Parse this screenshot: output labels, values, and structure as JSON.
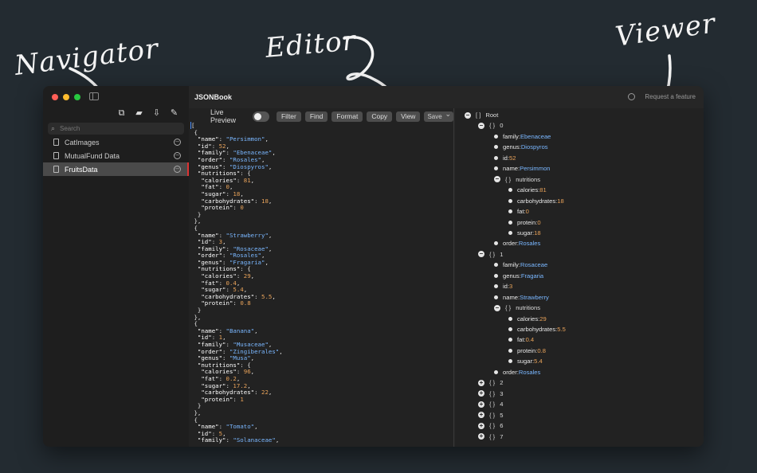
{
  "annotations": {
    "navigator": "Navigator",
    "editor": "Editor",
    "viewer": "Viewer"
  },
  "window": {
    "app_title": "JSONBook",
    "request_feature": "Request a feature"
  },
  "sidebar": {
    "search_placeholder": "Search",
    "files": [
      {
        "label": "CatImages",
        "selected": false
      },
      {
        "label": "MutualFund Data",
        "selected": false
      },
      {
        "label": "FruitsData",
        "selected": true
      }
    ]
  },
  "toolbar": {
    "live_preview": "Live Preview",
    "filter": "Filter",
    "find": "Find",
    "format": "Format",
    "copy": "Copy",
    "view": "View",
    "save": "Save"
  },
  "editor_lines": [
    [
      [
        "p",
        "["
      ]
    ],
    [
      [
        "p",
        " {"
      ]
    ],
    [
      [
        "k",
        "  \"name\""
      ],
      [
        "p",
        ": "
      ],
      [
        "s",
        "\"Persimmon\""
      ],
      [
        "p",
        ","
      ]
    ],
    [
      [
        "k",
        "  \"id\""
      ],
      [
        "p",
        ": "
      ],
      [
        "n",
        "52"
      ],
      [
        "p",
        ","
      ]
    ],
    [
      [
        "k",
        "  \"family\""
      ],
      [
        "p",
        ": "
      ],
      [
        "s",
        "\"Ebenaceae\""
      ],
      [
        "p",
        ","
      ]
    ],
    [
      [
        "k",
        "  \"order\""
      ],
      [
        "p",
        ": "
      ],
      [
        "s",
        "\"Rosales\""
      ],
      [
        "p",
        ","
      ]
    ],
    [
      [
        "k",
        "  \"genus\""
      ],
      [
        "p",
        ": "
      ],
      [
        "s",
        "\"Diospyros\""
      ],
      [
        "p",
        ","
      ]
    ],
    [
      [
        "k",
        "  \"nutritions\""
      ],
      [
        "p",
        ": {"
      ]
    ],
    [
      [
        "k",
        "   \"calories\""
      ],
      [
        "p",
        ": "
      ],
      [
        "n",
        "81"
      ],
      [
        "p",
        ","
      ]
    ],
    [
      [
        "k",
        "   \"fat\""
      ],
      [
        "p",
        ": "
      ],
      [
        "n",
        "0"
      ],
      [
        "p",
        ","
      ]
    ],
    [
      [
        "k",
        "   \"sugar\""
      ],
      [
        "p",
        ": "
      ],
      [
        "n",
        "18"
      ],
      [
        "p",
        ","
      ]
    ],
    [
      [
        "k",
        "   \"carbohydrates\""
      ],
      [
        "p",
        ": "
      ],
      [
        "n",
        "18"
      ],
      [
        "p",
        ","
      ]
    ],
    [
      [
        "k",
        "   \"protein\""
      ],
      [
        "p",
        ": "
      ],
      [
        "n",
        "0"
      ]
    ],
    [
      [
        "p",
        "  }"
      ]
    ],
    [
      [
        "p",
        " },"
      ]
    ],
    [
      [
        "p",
        " {"
      ]
    ],
    [
      [
        "k",
        "  \"name\""
      ],
      [
        "p",
        ": "
      ],
      [
        "s",
        "\"Strawberry\""
      ],
      [
        "p",
        ","
      ]
    ],
    [
      [
        "k",
        "  \"id\""
      ],
      [
        "p",
        ": "
      ],
      [
        "n",
        "3"
      ],
      [
        "p",
        ","
      ]
    ],
    [
      [
        "k",
        "  \"family\""
      ],
      [
        "p",
        ": "
      ],
      [
        "s",
        "\"Rosaceae\""
      ],
      [
        "p",
        ","
      ]
    ],
    [
      [
        "k",
        "  \"order\""
      ],
      [
        "p",
        ": "
      ],
      [
        "s",
        "\"Rosales\""
      ],
      [
        "p",
        ","
      ]
    ],
    [
      [
        "k",
        "  \"genus\""
      ],
      [
        "p",
        ": "
      ],
      [
        "s",
        "\"Fragaria\""
      ],
      [
        "p",
        ","
      ]
    ],
    [
      [
        "k",
        "  \"nutritions\""
      ],
      [
        "p",
        ": {"
      ]
    ],
    [
      [
        "k",
        "   \"calories\""
      ],
      [
        "p",
        ": "
      ],
      [
        "n",
        "29"
      ],
      [
        "p",
        ","
      ]
    ],
    [
      [
        "k",
        "   \"fat\""
      ],
      [
        "p",
        ": "
      ],
      [
        "n",
        "0.4"
      ],
      [
        "p",
        ","
      ]
    ],
    [
      [
        "k",
        "   \"sugar\""
      ],
      [
        "p",
        ": "
      ],
      [
        "n",
        "5.4"
      ],
      [
        "p",
        ","
      ]
    ],
    [
      [
        "k",
        "   \"carbohydrates\""
      ],
      [
        "p",
        ": "
      ],
      [
        "n",
        "5.5"
      ],
      [
        "p",
        ","
      ]
    ],
    [
      [
        "k",
        "   \"protein\""
      ],
      [
        "p",
        ": "
      ],
      [
        "n",
        "0.8"
      ]
    ],
    [
      [
        "p",
        "  }"
      ]
    ],
    [
      [
        "p",
        " },"
      ]
    ],
    [
      [
        "p",
        " {"
      ]
    ],
    [
      [
        "k",
        "  \"name\""
      ],
      [
        "p",
        ": "
      ],
      [
        "s",
        "\"Banana\""
      ],
      [
        "p",
        ","
      ]
    ],
    [
      [
        "k",
        "  \"id\""
      ],
      [
        "p",
        ": "
      ],
      [
        "n",
        "1"
      ],
      [
        "p",
        ","
      ]
    ],
    [
      [
        "k",
        "  \"family\""
      ],
      [
        "p",
        ": "
      ],
      [
        "s",
        "\"Musaceae\""
      ],
      [
        "p",
        ","
      ]
    ],
    [
      [
        "k",
        "  \"order\""
      ],
      [
        "p",
        ": "
      ],
      [
        "s",
        "\"Zingiberales\""
      ],
      [
        "p",
        ","
      ]
    ],
    [
      [
        "k",
        "  \"genus\""
      ],
      [
        "p",
        ": "
      ],
      [
        "s",
        "\"Musa\""
      ],
      [
        "p",
        ","
      ]
    ],
    [
      [
        "k",
        "  \"nutritions\""
      ],
      [
        "p",
        ": {"
      ]
    ],
    [
      [
        "k",
        "   \"calories\""
      ],
      [
        "p",
        ": "
      ],
      [
        "n",
        "96"
      ],
      [
        "p",
        ","
      ]
    ],
    [
      [
        "k",
        "   \"fat\""
      ],
      [
        "p",
        ": "
      ],
      [
        "n",
        "0.2"
      ],
      [
        "p",
        ","
      ]
    ],
    [
      [
        "k",
        "   \"sugar\""
      ],
      [
        "p",
        ": "
      ],
      [
        "n",
        "17.2"
      ],
      [
        "p",
        ","
      ]
    ],
    [
      [
        "k",
        "   \"carbohydrates\""
      ],
      [
        "p",
        ": "
      ],
      [
        "n",
        "22"
      ],
      [
        "p",
        ","
      ]
    ],
    [
      [
        "k",
        "   \"protein\""
      ],
      [
        "p",
        ": "
      ],
      [
        "n",
        "1"
      ]
    ],
    [
      [
        "p",
        "  }"
      ]
    ],
    [
      [
        "p",
        " },"
      ]
    ],
    [
      [
        "p",
        " {"
      ]
    ],
    [
      [
        "k",
        "  \"name\""
      ],
      [
        "p",
        ": "
      ],
      [
        "s",
        "\"Tomato\""
      ],
      [
        "p",
        ","
      ]
    ],
    [
      [
        "k",
        "  \"id\""
      ],
      [
        "p",
        ": "
      ],
      [
        "n",
        "5"
      ],
      [
        "p",
        ","
      ]
    ],
    [
      [
        "k",
        "  \"family\""
      ],
      [
        "p",
        ": "
      ],
      [
        "s",
        "\"Solanaceae\""
      ],
      [
        "p",
        ","
      ]
    ]
  ],
  "viewer_nodes": [
    {
      "depth": 0,
      "kind": "toggle-open",
      "bracket": "[ ]",
      "label": "Root"
    },
    {
      "depth": 1,
      "kind": "toggle-open",
      "bracket": "{ }",
      "label": "0"
    },
    {
      "depth": 2,
      "kind": "leaf",
      "key": "family",
      "value": "Ebenaceae",
      "vtype": "s"
    },
    {
      "depth": 2,
      "kind": "leaf",
      "key": "genus",
      "value": "Diospyros",
      "vtype": "s"
    },
    {
      "depth": 2,
      "kind": "leaf",
      "key": "id",
      "value": "52",
      "vtype": "n"
    },
    {
      "depth": 2,
      "kind": "leaf",
      "key": "name",
      "value": "Persimmon",
      "vtype": "s"
    },
    {
      "depth": 2,
      "kind": "toggle-open",
      "bracket": "{ }",
      "label": "nutritions"
    },
    {
      "depth": 3,
      "kind": "leaf",
      "key": "calories",
      "value": "81",
      "vtype": "n"
    },
    {
      "depth": 3,
      "kind": "leaf",
      "key": "carbohydrates",
      "value": "18",
      "vtype": "n"
    },
    {
      "depth": 3,
      "kind": "leaf",
      "key": "fat",
      "value": "0",
      "vtype": "n"
    },
    {
      "depth": 3,
      "kind": "leaf",
      "key": "protein",
      "value": "0",
      "vtype": "n"
    },
    {
      "depth": 3,
      "kind": "leaf",
      "key": "sugar",
      "value": "18",
      "vtype": "n"
    },
    {
      "depth": 2,
      "kind": "leaf",
      "key": "order",
      "value": "Rosales",
      "vtype": "s"
    },
    {
      "depth": 1,
      "kind": "toggle-open",
      "bracket": "{ }",
      "label": "1"
    },
    {
      "depth": 2,
      "kind": "leaf",
      "key": "family",
      "value": "Rosaceae",
      "vtype": "s"
    },
    {
      "depth": 2,
      "kind": "leaf",
      "key": "genus",
      "value": "Fragaria",
      "vtype": "s"
    },
    {
      "depth": 2,
      "kind": "leaf",
      "key": "id",
      "value": "3",
      "vtype": "n"
    },
    {
      "depth": 2,
      "kind": "leaf",
      "key": "name",
      "value": "Strawberry",
      "vtype": "s"
    },
    {
      "depth": 2,
      "kind": "toggle-open",
      "bracket": "{ }",
      "label": "nutritions"
    },
    {
      "depth": 3,
      "kind": "leaf",
      "key": "calories",
      "value": "29",
      "vtype": "n"
    },
    {
      "depth": 3,
      "kind": "leaf",
      "key": "carbohydrates",
      "value": "5.5",
      "vtype": "n"
    },
    {
      "depth": 3,
      "kind": "leaf",
      "key": "fat",
      "value": "0.4",
      "vtype": "n"
    },
    {
      "depth": 3,
      "kind": "leaf",
      "key": "protein",
      "value": "0.8",
      "vtype": "n"
    },
    {
      "depth": 3,
      "kind": "leaf",
      "key": "sugar",
      "value": "5.4",
      "vtype": "n"
    },
    {
      "depth": 2,
      "kind": "leaf",
      "key": "order",
      "value": "Rosales",
      "vtype": "s"
    },
    {
      "depth": 1,
      "kind": "toggle-closed",
      "bracket": "{ }",
      "label": "2"
    },
    {
      "depth": 1,
      "kind": "toggle-closed",
      "bracket": "{ }",
      "label": "3"
    },
    {
      "depth": 1,
      "kind": "toggle-closed",
      "bracket": "{ }",
      "label": "4"
    },
    {
      "depth": 1,
      "kind": "toggle-closed",
      "bracket": "{ }",
      "label": "5"
    },
    {
      "depth": 1,
      "kind": "toggle-closed",
      "bracket": "{ }",
      "label": "6"
    },
    {
      "depth": 1,
      "kind": "toggle-closed",
      "bracket": "{ }",
      "label": "7"
    }
  ],
  "colors": {
    "background": "#232b31",
    "string": "#7ab7ff",
    "number": "#e9a35a",
    "selection_accent": "#dd3333"
  }
}
